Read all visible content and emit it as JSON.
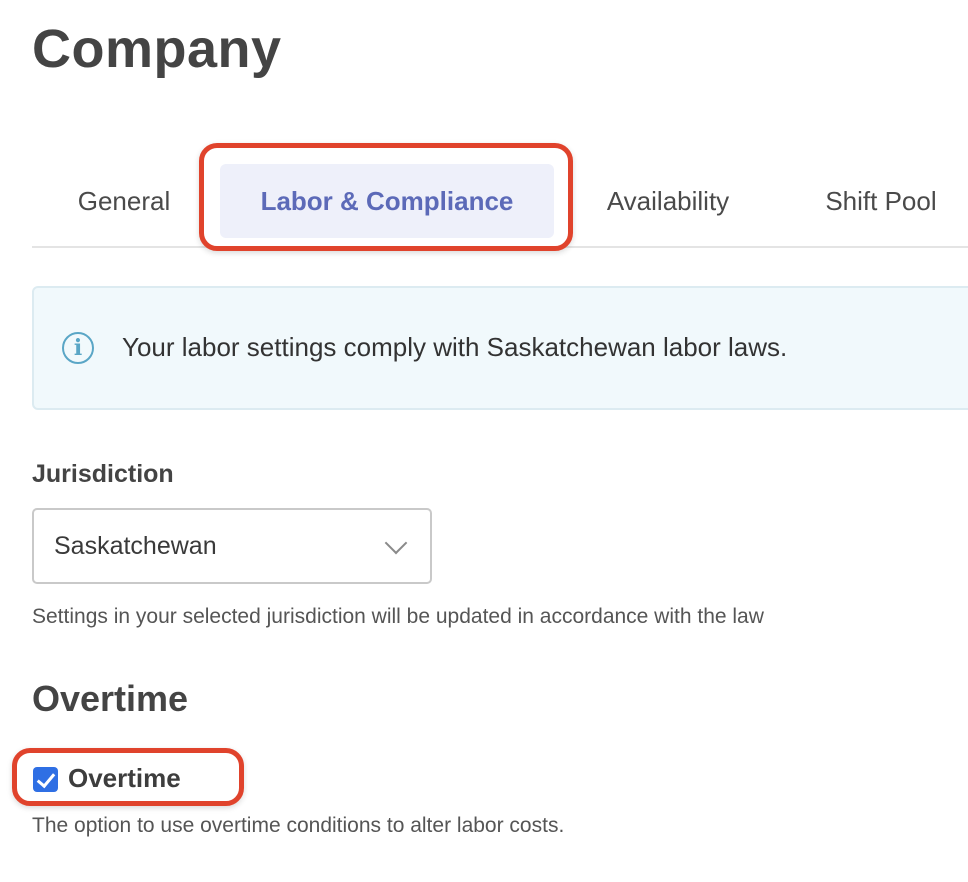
{
  "page": {
    "title": "Company"
  },
  "tabs": [
    {
      "label": "General",
      "active": false
    },
    {
      "label": "Labor & Compliance",
      "active": true
    },
    {
      "label": "Availability",
      "active": false
    },
    {
      "label": "Shift Pool",
      "active": false
    }
  ],
  "info_banner": {
    "icon": "info-icon",
    "icon_glyph": "i",
    "text": "Your labor settings comply with Saskatchewan labor laws."
  },
  "jurisdiction": {
    "label": "Jurisdiction",
    "selected": "Saskatchewan",
    "helper": "Settings in your selected jurisdiction will be updated in accordance with the law"
  },
  "overtime": {
    "section_title": "Overtime",
    "checkbox_label": "Overtime",
    "checked": true,
    "description": "The option to use overtime conditions to alter labor costs."
  },
  "colors": {
    "accent": "#5c6ab8",
    "highlight": "#e0432c",
    "checkbox": "#2f6fe4",
    "info": "#5aa6c6"
  }
}
